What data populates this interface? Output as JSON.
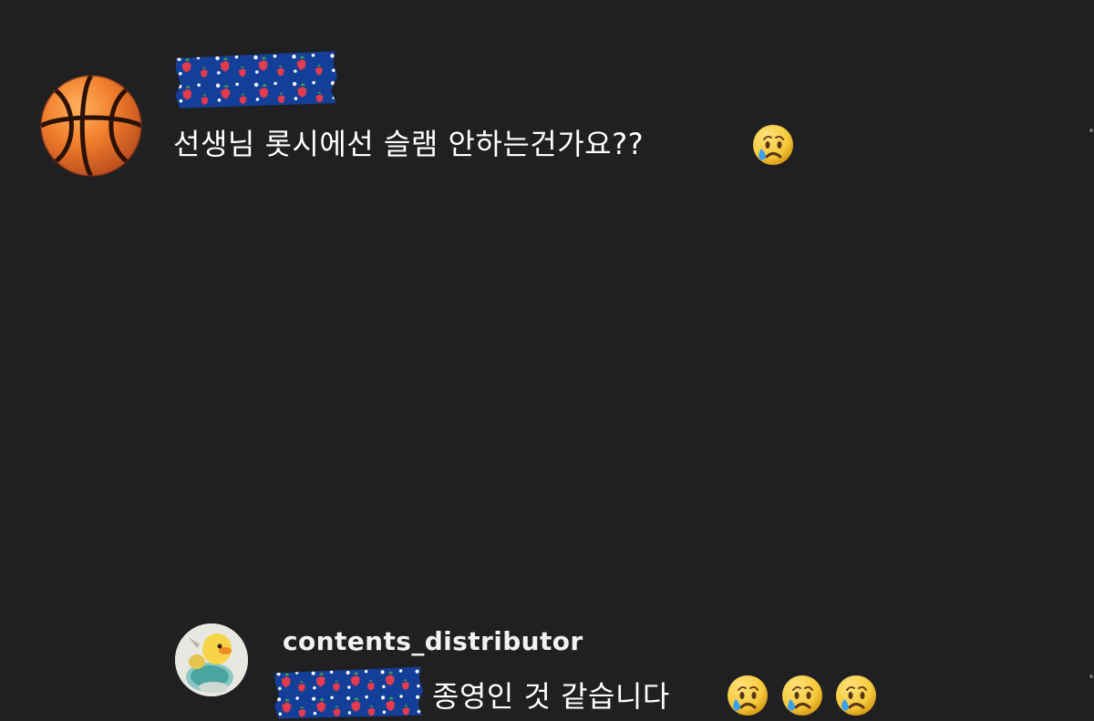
{
  "comment": {
    "username_sticker_icon": "strawberry-pattern-redaction-sticker",
    "avatar_icon": "basketball-icon",
    "text": "선생님 롯시에선 슬램 안하는건가요??",
    "emoji_icon": "crying-face-emoji"
  },
  "reply": {
    "avatar_icon": "duck-toy-avatar",
    "author": "contents_distributor",
    "mention_sticker_icon": "strawberry-pattern-redaction-sticker",
    "text": "종영인 것 같습니다",
    "emoji_icons": [
      "crying-face-emoji",
      "crying-face-emoji",
      "crying-face-emoji"
    ]
  },
  "colors": {
    "background": "#202022",
    "text": "#ffffff",
    "sticker_blue": "#143f98",
    "strawberry_red": "#e63b4d",
    "emoji_yellow": "#f5c93a",
    "tear_blue": "#3aa0ef"
  }
}
